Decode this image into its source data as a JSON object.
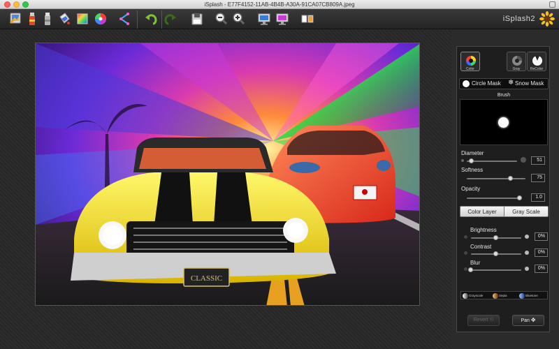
{
  "window": {
    "title": "iSplash - E77F4152-11AB-4B4B-A30A-91CA07CB809A.jpeg"
  },
  "toolbar": {
    "brand": "iSplash2",
    "buttons": [
      {
        "name": "open-image-icon"
      },
      {
        "name": "paint-tube-icon"
      },
      {
        "name": "eraser-tube-icon"
      },
      {
        "name": "paint-bucket-icon"
      },
      {
        "name": "gradient-square-icon"
      },
      {
        "name": "color-wheel-icon"
      },
      {
        "name": "share-icon"
      },
      {
        "name": "undo-icon"
      },
      {
        "name": "redo-icon"
      },
      {
        "name": "save-icon"
      },
      {
        "name": "zoom-out-icon"
      },
      {
        "name": "zoom-in-icon"
      },
      {
        "name": "monitor-original-icon"
      },
      {
        "name": "monitor-preview-icon"
      },
      {
        "name": "split-view-icon"
      }
    ]
  },
  "panel": {
    "modes": {
      "color": "Color",
      "gray": "Gray",
      "recolor": "ReColor"
    },
    "mask": {
      "circle": "Circle Mask",
      "snow": "Snow Mask"
    },
    "brush": {
      "title": "Brush",
      "diameter_label": "Diameter",
      "diameter_value": "51",
      "diameter_level": 0.1,
      "softness_label": "Softness",
      "softness_value": "75",
      "softness_level": 0.75,
      "opacity_label": "Opacity",
      "opacity_value": "1.0",
      "opacity_level": 1.0
    },
    "layer_tabs": {
      "color_layer": "Color Layer",
      "gray_scale": "Gray Scale"
    },
    "adjust": {
      "brightness_label": "Brightness",
      "brightness_value": "0%",
      "brightness_level": 0.5,
      "contrast_label": "Contrast",
      "contrast_value": "0%",
      "contrast_level": 0.5,
      "blur_label": "Blur",
      "blur_value": "0%",
      "blur_level": 0.0
    },
    "presets": {
      "grayscale": "Grayscale",
      "sepia": "Sepia",
      "bluetone": "Bluetone"
    },
    "actions": {
      "revert": "Revert",
      "pan": "Pan"
    }
  },
  "photo": {
    "license_plate": "CLASSIC"
  }
}
